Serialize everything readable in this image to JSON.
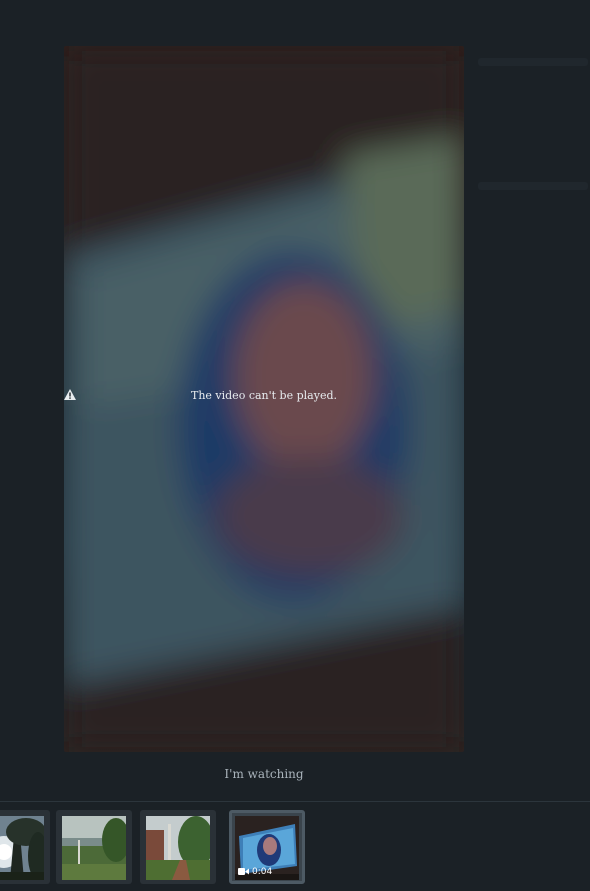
{
  "viewer": {
    "error_message": "The video can't be played.",
    "caption": "I'm watching",
    "icons": {
      "warning": "warning-icon",
      "video": "video-camera-icon"
    }
  },
  "thumbnails": [
    {
      "kind": "photo",
      "scene": "sun-through-trees"
    },
    {
      "kind": "photo",
      "scene": "green-hills-valley"
    },
    {
      "kind": "photo",
      "scene": "garden-path"
    },
    {
      "kind": "video",
      "scene": "selfie-video",
      "duration": "0:04",
      "selected": true
    }
  ],
  "colors": {
    "background": "#1b2126",
    "caption": "#a9b3bb",
    "active_border": "#4d5a64"
  }
}
